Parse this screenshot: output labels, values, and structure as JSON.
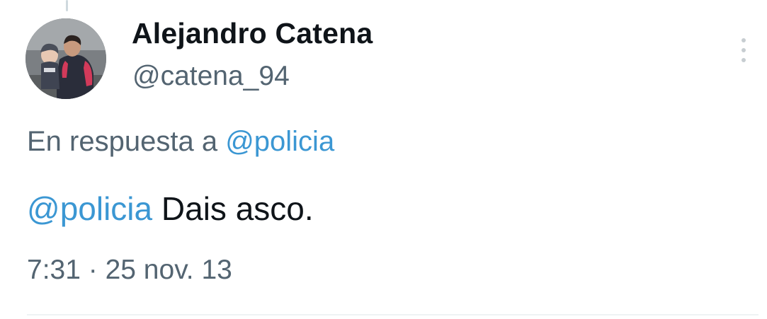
{
  "tweet": {
    "author": {
      "display_name": "Alejandro Catena",
      "handle": "@catena_94",
      "avatar_icon": "profile-photo"
    },
    "reply_context": {
      "prefix": "En respuesta a",
      "mention": "@policia"
    },
    "text": {
      "mention": "@policia",
      "body": "Dais asco."
    },
    "timestamp": {
      "time": "7:31",
      "separator": "·",
      "date": "25 nov. 13"
    },
    "more_icon": "vertical-ellipsis-icon"
  },
  "colors": {
    "text_primary": "#0f1419",
    "text_secondary": "#536471",
    "link": "#3b97d3",
    "divider": "#eff3f4"
  }
}
